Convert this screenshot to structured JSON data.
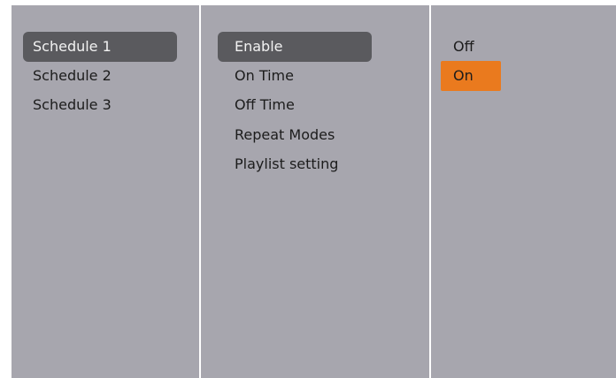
{
  "colors": {
    "panel_background": "#a7a6ae",
    "divider": "#ffffff",
    "highlight": "#5a5a5e",
    "selected": "#ea7a1e",
    "text": "#1c1c1c"
  },
  "schedule_menu": {
    "items": [
      {
        "label": "Schedule 1",
        "state": "highlighted"
      },
      {
        "label": "Schedule 2",
        "state": "normal"
      },
      {
        "label": "Schedule 3",
        "state": "normal"
      }
    ]
  },
  "settings_menu": {
    "items": [
      {
        "label": "Enable",
        "state": "highlighted"
      },
      {
        "label": "On Time",
        "state": "normal"
      },
      {
        "label": "Off Time",
        "state": "normal"
      },
      {
        "label": "Repeat Modes",
        "state": "normal"
      },
      {
        "label": "Playlist setting",
        "state": "normal"
      }
    ]
  },
  "value_menu": {
    "items": [
      {
        "label": "Off",
        "state": "normal"
      },
      {
        "label": "On",
        "state": "selected"
      }
    ]
  }
}
